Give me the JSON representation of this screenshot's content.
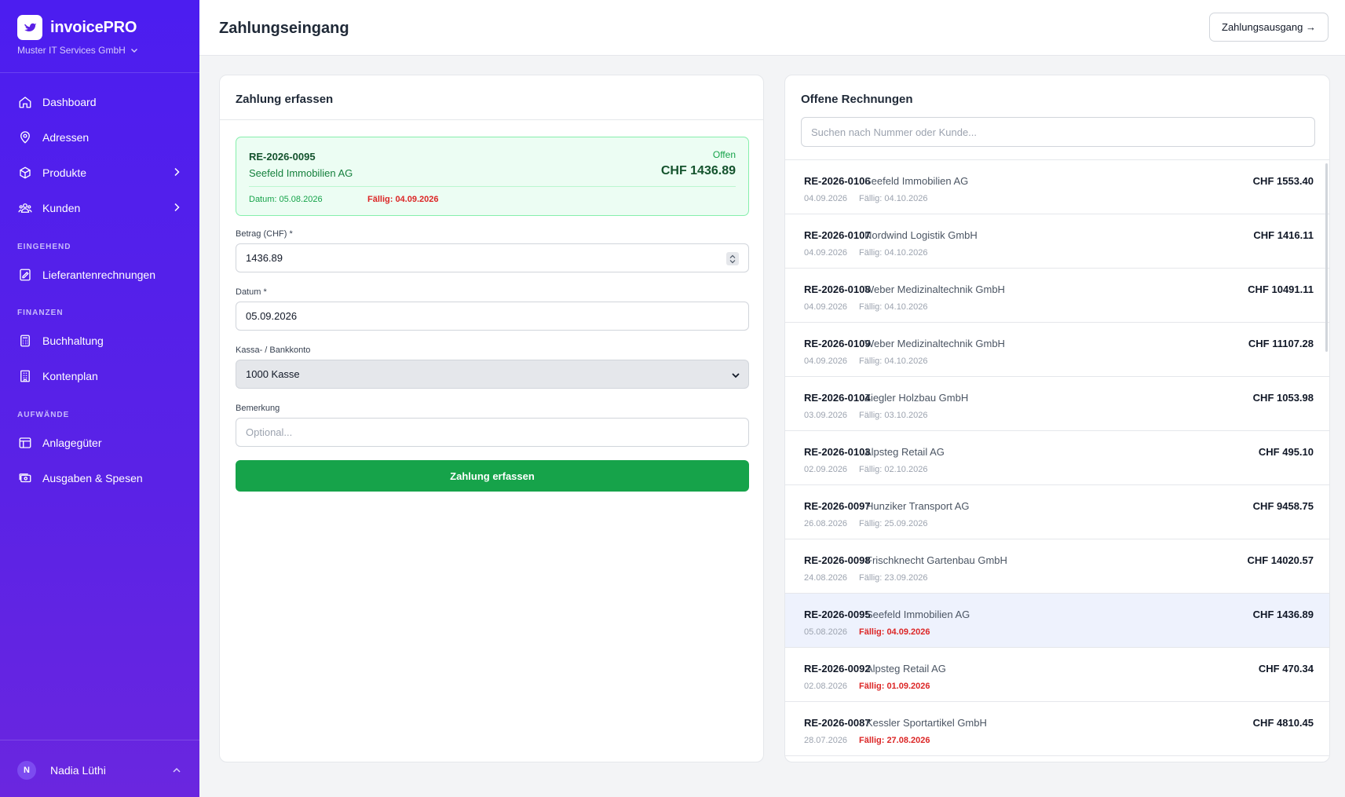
{
  "app": {
    "name": "invoicePRO",
    "company": "Muster IT Services GmbH"
  },
  "sidebar": {
    "items": [
      {
        "label": "Dashboard"
      },
      {
        "label": "Adressen"
      },
      {
        "label": "Produkte"
      },
      {
        "label": "Kunden"
      }
    ],
    "sections": {
      "eingehend": {
        "label": "EINGEHEND",
        "items": [
          {
            "label": "Lieferantenrechnungen"
          }
        ]
      },
      "finanzen": {
        "label": "FINANZEN",
        "items": [
          {
            "label": "Buchhaltung"
          },
          {
            "label": "Kontenplan"
          }
        ]
      },
      "aufwaende": {
        "label": "AUFWÄNDE",
        "items": [
          {
            "label": "Anlagegüter"
          },
          {
            "label": "Ausgaben & Spesen"
          }
        ]
      }
    },
    "user": {
      "initial": "N",
      "name": "Nadia Lüthi"
    }
  },
  "header": {
    "title": "Zahlungseingang",
    "outgoing_button": "Zahlungsausgang →"
  },
  "form": {
    "title": "Zahlung erfassen",
    "selected": {
      "number": "RE-2026-0095",
      "customer": "Seefeld Immobilien AG",
      "status": "Offen",
      "amount": "CHF 1436.89",
      "date": "Datum: 05.08.2026",
      "due": "Fällig: 04.09.2026"
    },
    "amount": {
      "label": "Betrag (CHF) *",
      "value": "1436.89"
    },
    "date": {
      "label": "Datum *",
      "value": "05.09.2026"
    },
    "account": {
      "label": "Kassa- / Bankkonto",
      "value": "1000 Kasse"
    },
    "note": {
      "label": "Bemerkung",
      "placeholder": "Optional..."
    },
    "submit": "Zahlung erfassen"
  },
  "open_invoices": {
    "title": "Offene Rechnungen",
    "search_placeholder": "Suchen nach Nummer oder Kunde...",
    "rows": [
      {
        "number": "RE-2026-0106",
        "customer": "Seefeld Immobilien AG",
        "amount": "CHF 1553.40",
        "date": "04.09.2026",
        "due": "Fällig: 04.10.2026",
        "overdue": false,
        "selected": false
      },
      {
        "number": "RE-2026-0107",
        "customer": "Nordwind Logistik GmbH",
        "amount": "CHF 1416.11",
        "date": "04.09.2026",
        "due": "Fällig: 04.10.2026",
        "overdue": false,
        "selected": false
      },
      {
        "number": "RE-2026-0108",
        "customer": "Weber Medizinaltechnik GmbH",
        "amount": "CHF 10491.11",
        "date": "04.09.2026",
        "due": "Fällig: 04.10.2026",
        "overdue": false,
        "selected": false
      },
      {
        "number": "RE-2026-0109",
        "customer": "Weber Medizinaltechnik GmbH",
        "amount": "CHF 11107.28",
        "date": "04.09.2026",
        "due": "Fällig: 04.10.2026",
        "overdue": false,
        "selected": false
      },
      {
        "number": "RE-2026-0104",
        "customer": "Ziegler Holzbau GmbH",
        "amount": "CHF 1053.98",
        "date": "03.09.2026",
        "due": "Fällig: 03.10.2026",
        "overdue": false,
        "selected": false
      },
      {
        "number": "RE-2026-0103",
        "customer": "Alpsteg Retail AG",
        "amount": "CHF 495.10",
        "date": "02.09.2026",
        "due": "Fällig: 02.10.2026",
        "overdue": false,
        "selected": false
      },
      {
        "number": "RE-2026-0097",
        "customer": "Hunziker Transport AG",
        "amount": "CHF 9458.75",
        "date": "26.08.2026",
        "due": "Fällig: 25.09.2026",
        "overdue": false,
        "selected": false
      },
      {
        "number": "RE-2026-0098",
        "customer": "Frischknecht Gartenbau GmbH",
        "amount": "CHF 14020.57",
        "date": "24.08.2026",
        "due": "Fällig: 23.09.2026",
        "overdue": false,
        "selected": false
      },
      {
        "number": "RE-2026-0095",
        "customer": "Seefeld Immobilien AG",
        "amount": "CHF 1436.89",
        "date": "05.08.2026",
        "due": "Fällig: 04.09.2026",
        "overdue": true,
        "selected": true
      },
      {
        "number": "RE-2026-0092",
        "customer": "Alpsteg Retail AG",
        "amount": "CHF 470.34",
        "date": "02.08.2026",
        "due": "Fällig: 01.09.2026",
        "overdue": true,
        "selected": false
      },
      {
        "number": "RE-2026-0087",
        "customer": "Kessler Sportartikel GmbH",
        "amount": "CHF 4810.45",
        "date": "28.07.2026",
        "due": "Fällig: 27.08.2026",
        "overdue": true,
        "selected": false
      }
    ]
  },
  "colors": {
    "sidebar": "#4c1df0",
    "accent_green": "#16a34a",
    "overdue_red": "#dc2626",
    "selected_row": "#eef2fd"
  }
}
